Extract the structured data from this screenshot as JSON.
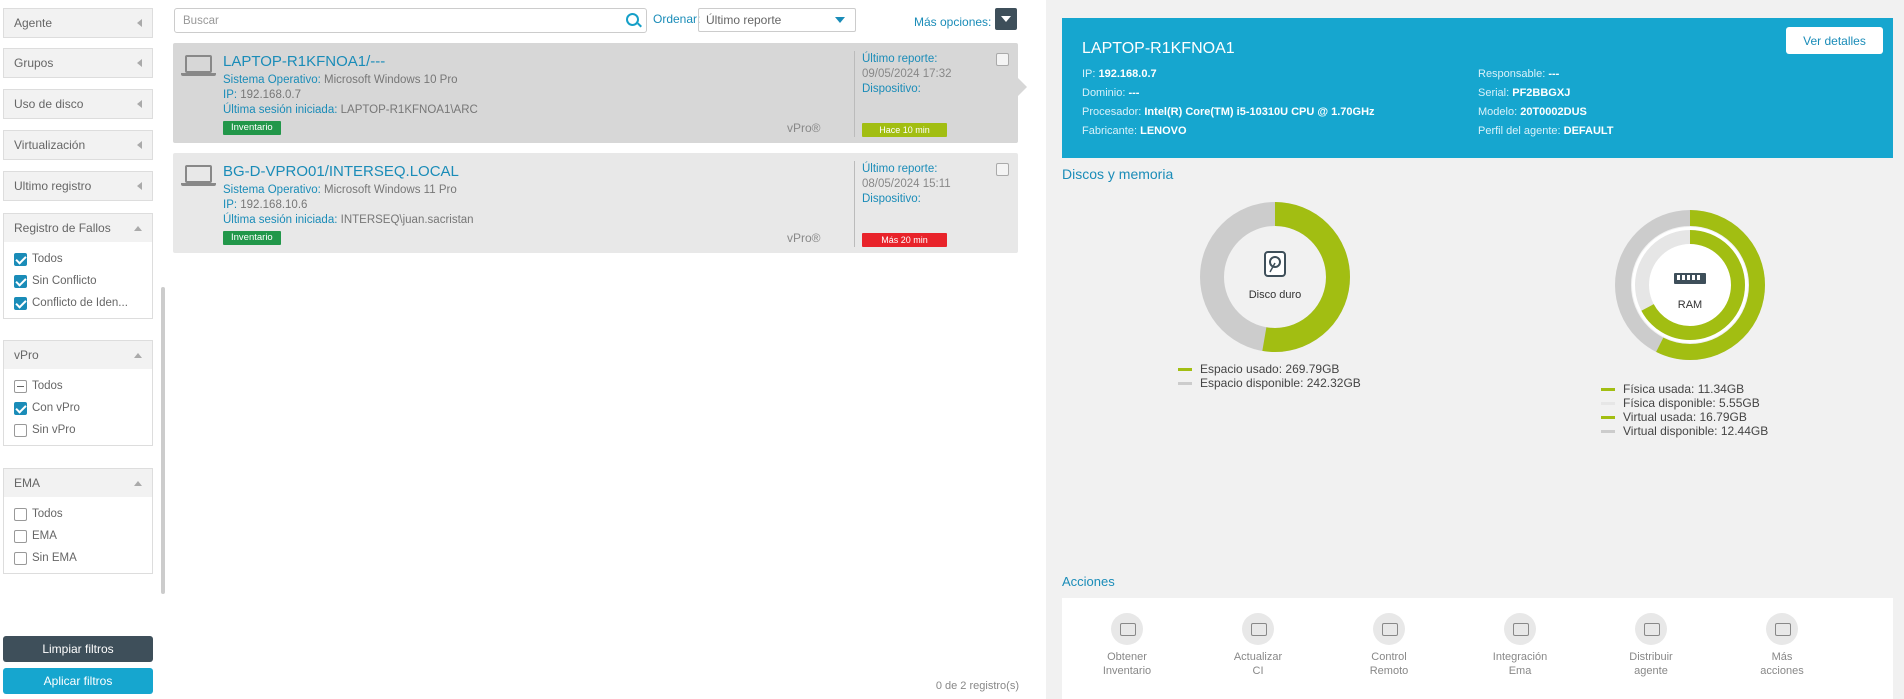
{
  "filters": {
    "collapsed": [
      {
        "label": "Agente"
      },
      {
        "label": "Grupos"
      },
      {
        "label": "Uso de disco"
      },
      {
        "label": "Virtualización"
      },
      {
        "label": "Ultimo registro"
      }
    ],
    "registro": {
      "title": "Registro de Fallos",
      "options": [
        {
          "label": "Todos",
          "checked": true
        },
        {
          "label": "Sin Conflicto",
          "checked": true
        },
        {
          "label": "Conflicto de Iden...",
          "checked": true
        }
      ]
    },
    "vpro": {
      "title": "vPro",
      "options": [
        {
          "label": "Todos",
          "state": "indeterminate"
        },
        {
          "label": "Con vPro",
          "checked": true
        },
        {
          "label": "Sin vPro",
          "checked": false
        }
      ]
    },
    "ema": {
      "title": "EMA",
      "options": [
        {
          "label": "Todos",
          "checked": false
        },
        {
          "label": "EMA",
          "checked": false
        },
        {
          "label": "Sin EMA",
          "checked": false
        }
      ]
    },
    "clear_label": "Limpiar filtros",
    "apply_label": "Aplicar filtros"
  },
  "toolbar": {
    "search_placeholder": "Buscar",
    "order_label": "Ordenar:",
    "order_value": "Último reporte",
    "more_label": "Más opciones:"
  },
  "devices": [
    {
      "name": "LAPTOP-R1KFNOA1/---",
      "os_key": "Sistema Operativo:",
      "os": "Microsoft Windows 10 Pro",
      "ip_key": "IP:",
      "ip": "192.168.0.7",
      "session_key": "Última sesión iniciada:",
      "session": "LAPTOP-R1KFNOA1\\ARC",
      "tag": "Inventario",
      "vpro": "vPro®",
      "report_key": "Último reporte:",
      "report": "09/05/2024 17:32",
      "device_key": "Dispositivo:",
      "status": "Hace 10 min",
      "status_color": "#a2be12"
    },
    {
      "name": "BG-D-VPRO01/INTERSEQ.LOCAL",
      "os_key": "Sistema Operativo:",
      "os": "Microsoft Windows 11 Pro",
      "ip_key": "IP:",
      "ip": "192.168.10.6",
      "session_key": "Última sesión iniciada:",
      "session": "INTERSEQ\\juan.sacristan",
      "tag": "Inventario",
      "vpro": "vPro®",
      "report_key": "Último reporte:",
      "report": "08/05/2024 15:11",
      "device_key": "Dispositivo:",
      "status": "Más 20 min",
      "status_color": "#e8232a"
    }
  ],
  "count": "0 de 2 registro(s)",
  "detail": {
    "title": "LAPTOP-R1KFNOA1",
    "details_button": "Ver detalles",
    "left": [
      {
        "k": "IP:",
        "v": "192.168.0.7"
      },
      {
        "k": "Dominio:",
        "v": "---"
      },
      {
        "k": "Procesador:",
        "v": "Intel(R) Core(TM) i5-10310U CPU @ 1.70GHz"
      },
      {
        "k": "Fabricante:",
        "v": "LENOVO"
      }
    ],
    "right": [
      {
        "k": "Responsable:",
        "v": "---"
      },
      {
        "k": "Serial:",
        "v": "PF2BBGXJ"
      },
      {
        "k": "Modelo:",
        "v": "20T0002DUS"
      },
      {
        "k": "Perfil del agente:",
        "v": "DEFAULT"
      }
    ]
  },
  "disks": {
    "title": "Discos y memoria",
    "disk": {
      "label": "Disco duro",
      "used": 269.79,
      "available": 242.32,
      "legend": [
        "Espacio usado: 269.79GB",
        "Espacio disponible: 242.32GB"
      ]
    },
    "ram": {
      "label": "RAM",
      "physical_used": 11.34,
      "physical_available": 5.55,
      "virtual_used": 16.79,
      "virtual_available": 12.44,
      "legend": [
        "Física usada: 11.34GB",
        "Física disponible: 5.55GB",
        "Virtual usada: 16.79GB",
        "Virtual disponible: 12.44GB"
      ]
    },
    "colors": {
      "used": "#a2be12",
      "free": "#cccccc",
      "free_light": "#e6e6e6"
    }
  },
  "actions": {
    "title": "Acciones",
    "items": [
      {
        "line1": "Obtener",
        "line2": "Inventario",
        "icon": "inventory-icon"
      },
      {
        "line1": "Actualizar",
        "line2": "CI",
        "icon": "update-ci-icon"
      },
      {
        "line1": "Control",
        "line2": "Remoto",
        "icon": "binoculars-icon"
      },
      {
        "line1": "Integración",
        "line2": "Ema",
        "icon": "ema-icon"
      },
      {
        "line1": "Distribuir",
        "line2": "agente",
        "icon": "distribute-icon"
      },
      {
        "line1": "Más",
        "line2": "acciones",
        "icon": "more-actions-icon"
      }
    ]
  }
}
